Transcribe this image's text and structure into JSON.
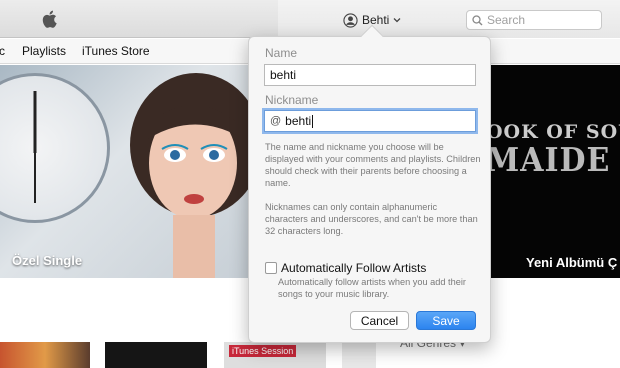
{
  "toolbar": {
    "account_name": "Behti",
    "search_placeholder": "Search",
    "apple_icon": "apple-logo-icon",
    "account_icon": "user-circle-icon",
    "search_icon": "magnifier-icon"
  },
  "nav": {
    "tabs": [
      {
        "label": "c"
      },
      {
        "label": "Playlists"
      },
      {
        "label": "iTunes Store"
      }
    ]
  },
  "hero": {
    "left_caption": "Özel Single",
    "right_caption": "Yeni Albümü Ç",
    "right_art_line1": "OOK OF SOU",
    "right_art_line2": "MAIDE"
  },
  "thumbs": {
    "session_badge": "iTunes Session",
    "genres_label": "All Genres ▾"
  },
  "popover": {
    "name_label": "Name",
    "name_value": "behti",
    "nickname_label": "Nickname",
    "nickname_prefix": "@",
    "nickname_value": "behti",
    "help_text_1": "The name and nickname you choose will be displayed with your comments and playlists. Children should check with their parents before choosing a name.",
    "help_text_2": "Nicknames can only contain alphanumeric characters and underscores, and can't be more than 32 characters long.",
    "follow_label": "Automatically Follow Artists",
    "follow_checked": false,
    "follow_help": "Automatically follow artists when you add their songs to your music library.",
    "cancel_label": "Cancel",
    "save_label": "Save",
    "accent_color": "#2c84ef"
  }
}
